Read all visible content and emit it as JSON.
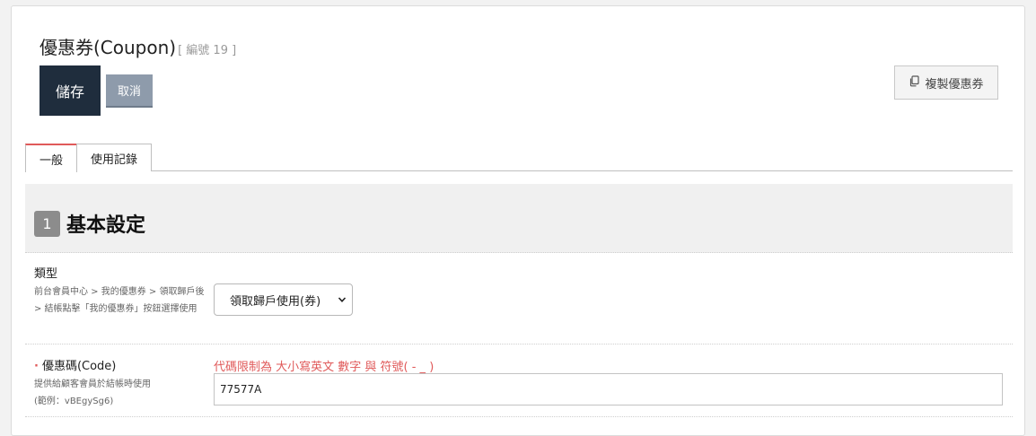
{
  "header": {
    "title": "優惠券(Coupon)",
    "subtitle": "[ 編號 19 ]"
  },
  "toolbar": {
    "save_label": "儲存",
    "cancel_label": "取消",
    "copy_label": "複製優惠券"
  },
  "tabs": [
    {
      "label": "一般",
      "active": true
    },
    {
      "label": "使用記錄",
      "active": false
    }
  ],
  "section": {
    "number": "1",
    "title": "基本設定"
  },
  "fields": {
    "type": {
      "label": "類型",
      "help": "前台會員中心 > 我的優惠券 > 領取歸戶後 > 結帳點擊「我的優惠券」按鈕選擇使用",
      "selected": "領取歸戶使用(券)"
    },
    "code": {
      "required_mark": "·",
      "label": "優惠碼(Code)",
      "help": "提供給顧客會員於結帳時使用",
      "example": "(範例：vBEgySg6)",
      "hint": "代碼限制為 大小寫英文 數字 與 符號( - _ )",
      "value": "77577A"
    }
  },
  "colors": {
    "save_button": "#1f2d3d",
    "cancel_button": "#8e9bab",
    "accent_red": "#e05a5a",
    "section_bg": "#f0f0f0"
  }
}
